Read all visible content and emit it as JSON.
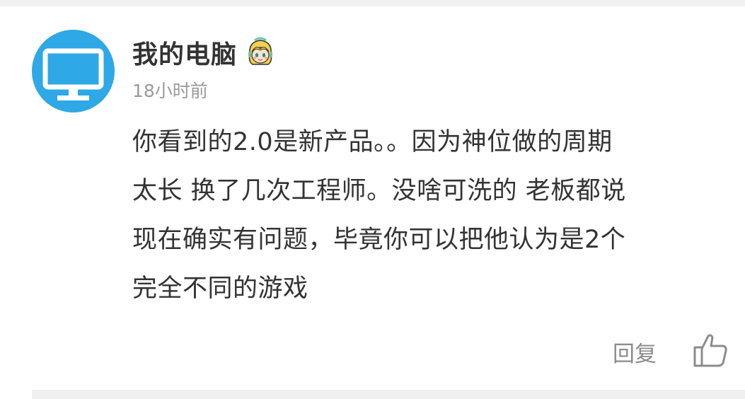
{
  "comment": {
    "username": "我的电脑",
    "badge_icon": "anime-girl-badge-icon",
    "avatar_icon": "computer-monitor-icon",
    "avatar_color": "#2ea8e6",
    "timestamp": "18小时前",
    "content_lines": [
      "你看到的2.0是新产品。。因为神位做的周期",
      "太长 换了几次工程师。没啥可洗的 老板都说",
      "现在确实有问题，毕竟你可以把他认为是2个",
      "完全不同的游戏"
    ],
    "reply_label": "回复",
    "like_icon": "thumbs-up-icon"
  }
}
